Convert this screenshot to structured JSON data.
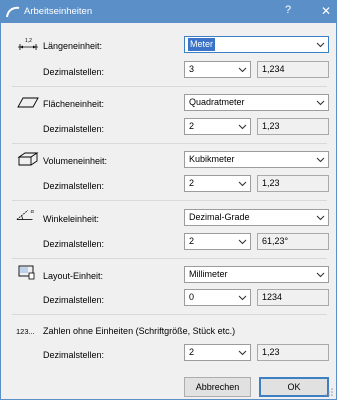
{
  "window": {
    "title": "Arbeitseinheiten",
    "help_glyph": "?",
    "close_glyph": "✕",
    "titlebar_color": "#5b8fc7",
    "icon": "archicad-arc-icon"
  },
  "sections": {
    "length": {
      "icon": "length-dimension-icon",
      "icon_text": "1,2",
      "unit_label": "Längeneinheit:",
      "unit_value": "Meter",
      "decimals_label": "Dezimalstellen:",
      "decimals_value": "3",
      "preview": "1,234"
    },
    "area": {
      "icon": "area-parallelogram-icon",
      "unit_label": "Flächeneinheit:",
      "unit_value": "Quadratmeter",
      "decimals_label": "Dezimalstellen:",
      "decimals_value": "2",
      "preview": "1,23"
    },
    "volume": {
      "icon": "volume-box-icon",
      "unit_label": "Volumeneinheit:",
      "unit_value": "Kubikmeter",
      "decimals_label": "Dezimalstellen:",
      "decimals_value": "2",
      "preview": "1,23"
    },
    "angle": {
      "icon": "angle-icon",
      "icon_text": "α",
      "unit_label": "Winkeleinheit:",
      "unit_value": "Dezimal-Grade",
      "decimals_label": "Dezimalstellen:",
      "decimals_value": "2",
      "preview": "61,23°"
    },
    "layout": {
      "icon": "layout-sheet-icon",
      "unit_label": "Layout-Einheit:",
      "unit_value": "Millimeter",
      "decimals_label": "Dezimalstellen:",
      "decimals_value": "0",
      "preview": "1234"
    },
    "unitless": {
      "icon_text": "123...",
      "label": "Zahlen ohne Einheiten (Schriftgröße, Stück etc.)",
      "decimals_label": "Dezimalstellen:",
      "decimals_value": "2",
      "preview": "1,23"
    }
  },
  "buttons": {
    "cancel": "Abbrechen",
    "ok": "OK"
  }
}
